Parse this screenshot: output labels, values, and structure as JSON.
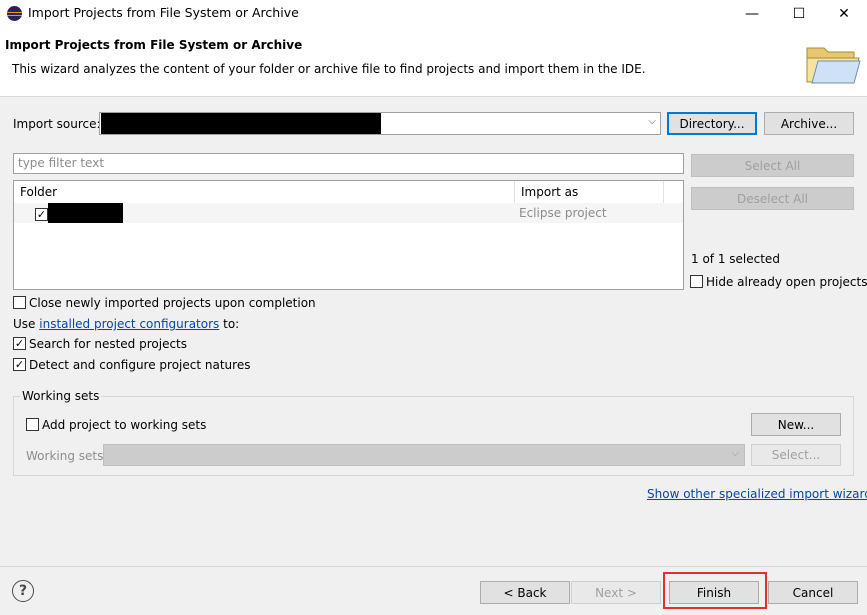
{
  "window": {
    "title": "Import Projects from File System or Archive",
    "icon": "eclipse-icon",
    "controls": {
      "minimize": "—",
      "maximize": "☐",
      "close": "✕"
    }
  },
  "header": {
    "title": "Import Projects from File System or Archive",
    "description": "This wizard analyzes the content of your folder or archive file to find projects and import them in the IDE.",
    "icon": "folder-icon"
  },
  "import_source": {
    "label": "Import source:",
    "value": "",
    "directory_button": "Directory...",
    "archive_button": "Archive..."
  },
  "filter": {
    "placeholder": "type filter text"
  },
  "table": {
    "columns": [
      "Folder",
      "Import as"
    ],
    "rows": [
      {
        "folder": "",
        "checked": true,
        "import_as": "Eclipse project"
      }
    ]
  },
  "side_buttons": {
    "select_all": "Select All",
    "deselect_all": "Deselect All",
    "selected_count": "1 of 1 selected",
    "hide_open_label": "Hide already open projects",
    "hide_open_checked": false
  },
  "options": {
    "close_after": {
      "label": "Close newly imported projects upon completion",
      "checked": false
    },
    "use_prefix": "Use",
    "configurators_link": "installed project configurators",
    "use_suffix": "to:",
    "nested": {
      "label": "Search for nested projects",
      "checked": true
    },
    "natures": {
      "label": "Detect and configure project natures",
      "checked": true
    }
  },
  "working_sets": {
    "title": "Working sets",
    "add_label": "Add project to working sets",
    "add_checked": false,
    "new_button": "New...",
    "sets_label": "Working sets:",
    "select_button": "Select..."
  },
  "other_link": "Show other specialized import wizards",
  "footer": {
    "help": "?",
    "back": "< Back",
    "next": "Next >",
    "finish": "Finish",
    "cancel": "Cancel"
  },
  "colors": {
    "highlight": "#e03030",
    "link": "#0645ad",
    "focus": "#0078d7"
  }
}
